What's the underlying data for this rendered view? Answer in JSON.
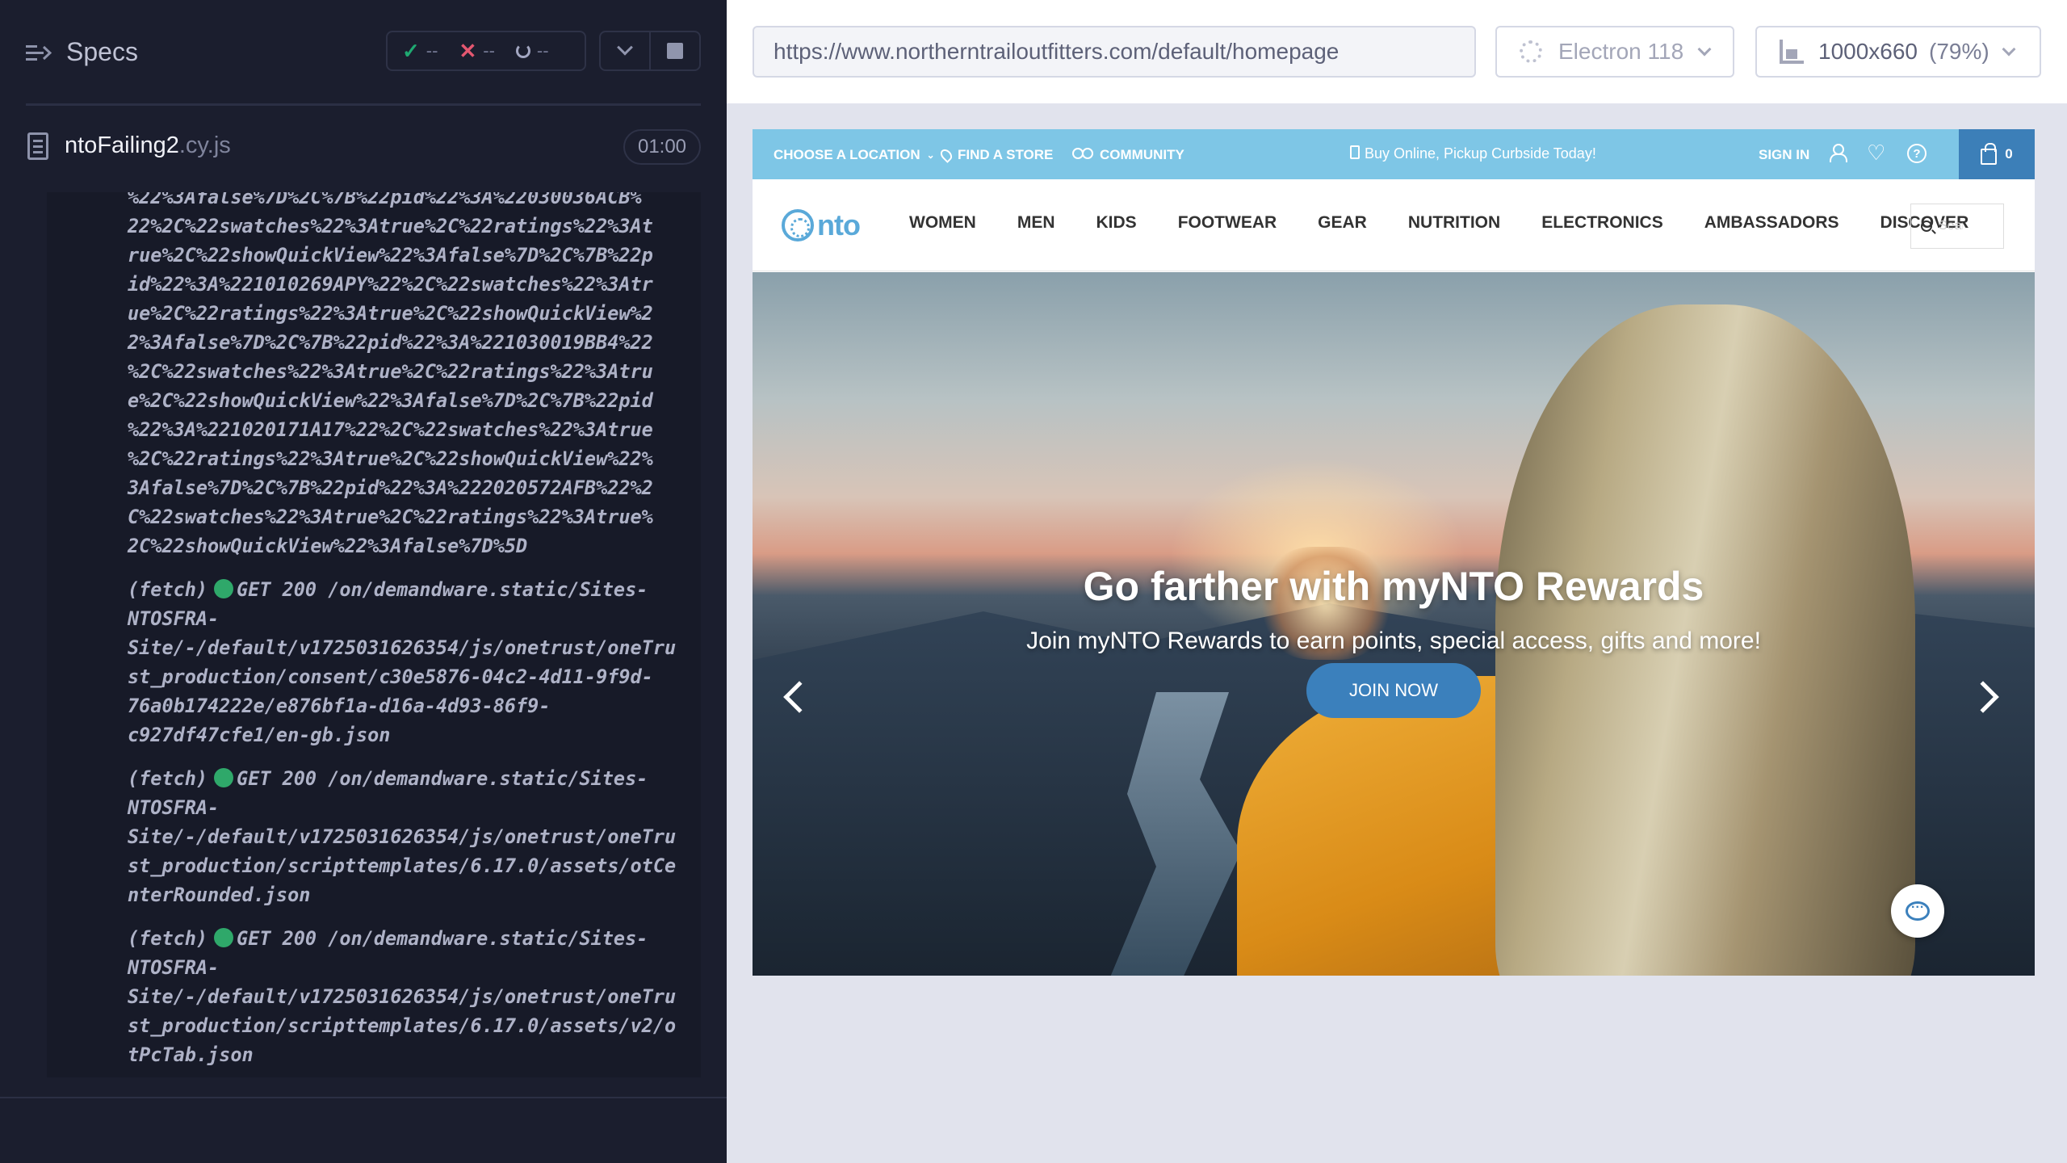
{
  "reporter": {
    "title": "Specs",
    "stats": {
      "passed": "--",
      "failed": "--",
      "pending": "--"
    },
    "spec": {
      "name": "ntoFailing2",
      "ext": ".cy.js",
      "duration": "01:00"
    },
    "log_blob": "%22%3Afalse%7D%2C%7B%22pid%22%3A%22030036ACB%\n22%2C%22swatches%22%3Atrue%2C%22ratings%22%3At\nrue%2C%22showQuickView%22%3Afalse%7D%2C%7B%22p\nid%22%3A%221010269APY%22%2C%22swatches%22%3Atr\nue%2C%22ratings%22%3Atrue%2C%22showQuickView%2\n2%3Afalse%7D%2C%7B%22pid%22%3A%221030019BB4%22\n%2C%22swatches%22%3Atrue%2C%22ratings%22%3Atru\ne%2C%22showQuickView%22%3Afalse%7D%2C%7B%22pid\n%22%3A%221020171A17%22%2C%22swatches%22%3Atrue\n%2C%22ratings%22%3Atrue%2C%22showQuickView%22%\n3Afalse%7D%2C%7B%22pid%22%3A%222020572AFB%22%2\nC%22swatches%22%3Atrue%2C%22ratings%22%3Atrue%\n2C%22showQuickView%22%3Afalse%7D%5D",
    "entries": [
      {
        "prefix": "(fetch)",
        "status": "GET 200 /on/demandware.static/Sites-",
        "rest": "NTOSFRA-\nSite/-/default/v1725031626354/js/onetrust/oneTru\nst_production/consent/c30e5876-04c2-4d11-9f9d-\n76a0b174222e/e876bf1a-d16a-4d93-86f9-\nc927df47cfe1/en-gb.json"
      },
      {
        "prefix": "(fetch)",
        "status": "GET 200 /on/demandware.static/Sites-",
        "rest": "NTOSFRA-\nSite/-/default/v1725031626354/js/onetrust/oneTru\nst_production/scripttemplates/6.17.0/assets/otCe\nnterRounded.json"
      },
      {
        "prefix": "(fetch)",
        "status": "GET 200 /on/demandware.static/Sites-",
        "rest": "NTOSFRA-\nSite/-/default/v1725031626354/js/onetrust/oneTru\nst_production/scripttemplates/6.17.0/assets/v2/o\ntPcTab.json"
      }
    ]
  },
  "toolbar": {
    "url": "https://www.northerntrailoutfitters.com/default/homepage",
    "browser": "Electron 118",
    "viewport": "1000x660",
    "scale": "(79%)"
  },
  "site": {
    "promo": {
      "location": "CHOOSE A LOCATION",
      "find_store": "FIND A STORE",
      "community": "COMMUNITY",
      "center": "Buy Online, Pickup Curbside Today!",
      "sign_in": "SIGN IN",
      "cart_count": "0"
    },
    "logo": "nto",
    "nav": [
      "WOMEN",
      "MEN",
      "KIDS",
      "FOOTWEAR",
      "GEAR",
      "NUTRITION",
      "ELECTRONICS",
      "AMBASSADORS",
      "DISCOVER"
    ],
    "search_placeholder": "Search",
    "hero": {
      "title": "Go farther with myNTO Rewards",
      "subtitle": "Join myNTO Rewards to earn points, special access, gifts and more!",
      "cta": "JOIN NOW"
    }
  },
  "colors": {
    "reporter_bg": "#1b1e2e",
    "promo_bar": "#7ec6e6",
    "brand_blue": "#3b80bc",
    "pass": "#1fa971",
    "fail": "#e45770"
  }
}
